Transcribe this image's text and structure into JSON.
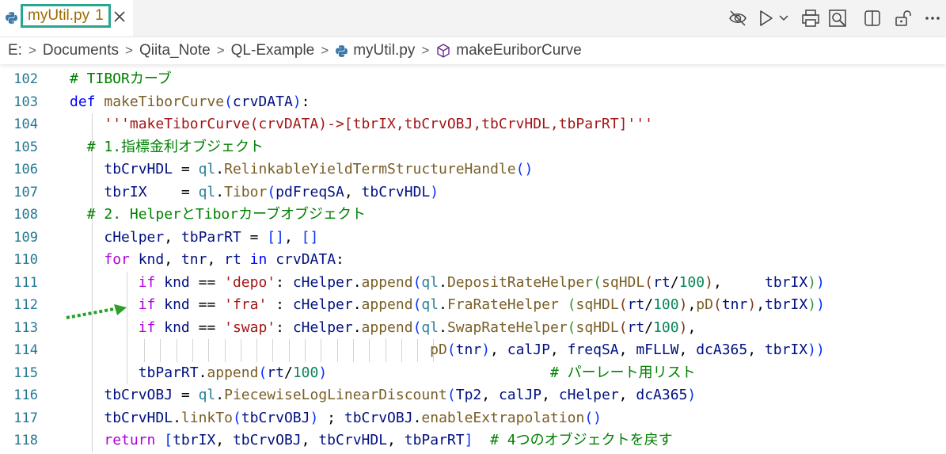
{
  "tab": {
    "title": "myUtil.py",
    "problems": "1"
  },
  "actions": [
    "eye-off-icon",
    "run-icon",
    "run-dropdown-icon",
    "print-icon",
    "search-preview-icon",
    "split-editor-icon",
    "unlock-icon",
    "more-icon"
  ],
  "breadcrumb": {
    "items": [
      "E:",
      "Documents",
      "Qiita_Note",
      "QL-Example",
      "myUtil.py",
      "makeEuriborCurve"
    ]
  },
  "colors": {
    "keyword": "#0000ff",
    "control": "#af00db",
    "function": "#795e26",
    "string": "#a31515",
    "comment": "#008000",
    "number": "#098658",
    "variable": "#001080",
    "module": "#267f99",
    "line_number": "#237893",
    "tab_highlight": "#2aa68f",
    "arrow": "#2aa02a"
  },
  "code": {
    "line_numbers": [
      "102",
      "103",
      "104",
      "105",
      "106",
      "107",
      "108",
      "109",
      "110",
      "111",
      "112",
      "113",
      "114",
      "115",
      "116",
      "117",
      "118"
    ],
    "lines": [
      "# TIBORカーブ",
      "def makeTiborCurve(crvDATA):",
      "    '''makeTiborCurve(crvDATA)->[tbrIX,tbCrvOBJ,tbCrvHDL,tbParRT]'''",
      "  # 1.指標金利オブジェクト",
      "    tbCrvHDL = ql.RelinkableYieldTermStructureHandle()",
      "    tbrIX    = ql.Tibor(pdFreqSA, tbCrvHDL)",
      "  # 2. HelperとTiborカーブオブジェクト",
      "    cHelper, tbParRT = [], []",
      "    for knd, tnr, rt in crvDATA:",
      "        if knd == 'depo': cHelper.append(ql.DepositRateHelper(sqHDL(rt/100),     tbrIX))",
      "        if knd == 'fra' : cHelper.append(ql.FraRateHelper (sqHDL(rt/100),pD(tnr),tbrIX))",
      "        if knd == 'swap': cHelper.append(ql.SwapRateHelper(sqHDL(rt/100),",
      "                                          pD(tnr), calJP, freqSA, mFLLW, dcA365, tbrIX))",
      "        tbParRT.append(rt/100)                          # パーレート用リスト",
      "    tbCrvOBJ = ql.PiecewiseLogLinearDiscount(Tp2, calJP, cHelper, dcA365)",
      "    tbCrvHDL.linkTo(tbCrvOBJ) ; tbCrvOBJ.enableExtrapolation()",
      "    return [tbrIX, tbCrvOBJ, tbCrvHDL, tbParRT]  # 4つのオブジェクトを戻す"
    ]
  }
}
